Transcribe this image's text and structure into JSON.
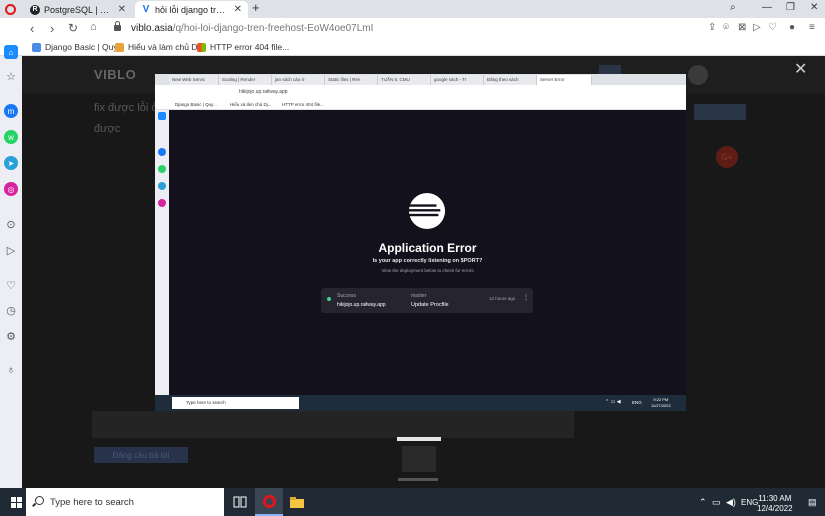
{
  "browser": {
    "tabs": [
      {
        "title": "PostgreSQL | Railway",
        "active": false
      },
      {
        "title": "hỏi lỗi django trên freehost",
        "active": true
      }
    ],
    "new_tab": "+",
    "url_host": "viblo.asia",
    "url_path": "/q/hoi-loi-django-tren-freehost-EoW4oe07LmI",
    "bookmarks": [
      {
        "label": "Django Basic | Quy..."
      },
      {
        "label": "Hiểu và làm chủ Dj..."
      },
      {
        "label": "HTTP error 404 file..."
      }
    ]
  },
  "background_page": {
    "logo": "VIBLO",
    "lines": [
      "fix được lỗi ở",
      "được"
    ],
    "avatar_badge": "G+",
    "reply_button": "Đăng câu trả lời",
    "search_placeholder": "Type here to search"
  },
  "screenshot": {
    "tabs": [
      "New Web Servic",
      "Scaling | Render",
      "jan sách cảo ở",
      "Static files | Ren",
      "TUẦN 6: CMU",
      "google sách - Tr",
      "Đăng theo sách",
      "Server Error"
    ],
    "url": "hikijojo.up.railway.app",
    "bookmarks": [
      "Django Basic | Quy...",
      "Hiểu và làm chủ Dj...",
      "HTTP error 404 file..."
    ],
    "error_title": "Application Error",
    "error_subtitle": "Is your app correctly listening on $PORT?",
    "error_hint": "View the deployment below to check for errors",
    "deployment": {
      "status": "Success",
      "host": "hikijojo.up.railway.app",
      "branch": "master",
      "commit": "Update Procfile",
      "time": "12 hours ago"
    },
    "taskbar_search": "Type here to search",
    "lang": "ENG",
    "clock_time": "9:22 PM",
    "clock_date": "11/27/2022"
  },
  "taskbar": {
    "search_placeholder": "Type here to search",
    "lang": "ENG",
    "time": "11:30 AM",
    "date": "12/4/2022"
  },
  "colors": {
    "opera_red": "#e0161c",
    "railway_bg": "#13111c",
    "success_green": "#3ed28a"
  }
}
